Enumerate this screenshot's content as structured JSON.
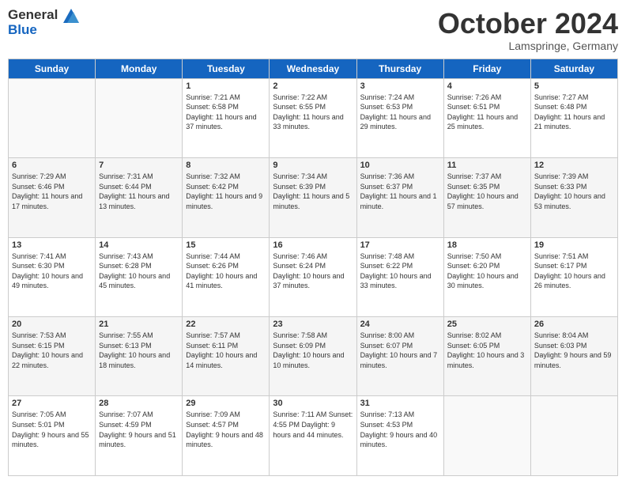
{
  "logo": {
    "line1": "General",
    "line2": "Blue"
  },
  "title": "October 2024",
  "location": "Lamspringe, Germany",
  "days_of_week": [
    "Sunday",
    "Monday",
    "Tuesday",
    "Wednesday",
    "Thursday",
    "Friday",
    "Saturday"
  ],
  "weeks": [
    [
      {
        "day": "",
        "info": ""
      },
      {
        "day": "",
        "info": ""
      },
      {
        "day": "1",
        "info": "Sunrise: 7:21 AM\nSunset: 6:58 PM\nDaylight: 11 hours and 37 minutes."
      },
      {
        "day": "2",
        "info": "Sunrise: 7:22 AM\nSunset: 6:55 PM\nDaylight: 11 hours and 33 minutes."
      },
      {
        "day": "3",
        "info": "Sunrise: 7:24 AM\nSunset: 6:53 PM\nDaylight: 11 hours and 29 minutes."
      },
      {
        "day": "4",
        "info": "Sunrise: 7:26 AM\nSunset: 6:51 PM\nDaylight: 11 hours and 25 minutes."
      },
      {
        "day": "5",
        "info": "Sunrise: 7:27 AM\nSunset: 6:48 PM\nDaylight: 11 hours and 21 minutes."
      }
    ],
    [
      {
        "day": "6",
        "info": "Sunrise: 7:29 AM\nSunset: 6:46 PM\nDaylight: 11 hours and 17 minutes."
      },
      {
        "day": "7",
        "info": "Sunrise: 7:31 AM\nSunset: 6:44 PM\nDaylight: 11 hours and 13 minutes."
      },
      {
        "day": "8",
        "info": "Sunrise: 7:32 AM\nSunset: 6:42 PM\nDaylight: 11 hours and 9 minutes."
      },
      {
        "day": "9",
        "info": "Sunrise: 7:34 AM\nSunset: 6:39 PM\nDaylight: 11 hours and 5 minutes."
      },
      {
        "day": "10",
        "info": "Sunrise: 7:36 AM\nSunset: 6:37 PM\nDaylight: 11 hours and 1 minute."
      },
      {
        "day": "11",
        "info": "Sunrise: 7:37 AM\nSunset: 6:35 PM\nDaylight: 10 hours and 57 minutes."
      },
      {
        "day": "12",
        "info": "Sunrise: 7:39 AM\nSunset: 6:33 PM\nDaylight: 10 hours and 53 minutes."
      }
    ],
    [
      {
        "day": "13",
        "info": "Sunrise: 7:41 AM\nSunset: 6:30 PM\nDaylight: 10 hours and 49 minutes."
      },
      {
        "day": "14",
        "info": "Sunrise: 7:43 AM\nSunset: 6:28 PM\nDaylight: 10 hours and 45 minutes."
      },
      {
        "day": "15",
        "info": "Sunrise: 7:44 AM\nSunset: 6:26 PM\nDaylight: 10 hours and 41 minutes."
      },
      {
        "day": "16",
        "info": "Sunrise: 7:46 AM\nSunset: 6:24 PM\nDaylight: 10 hours and 37 minutes."
      },
      {
        "day": "17",
        "info": "Sunrise: 7:48 AM\nSunset: 6:22 PM\nDaylight: 10 hours and 33 minutes."
      },
      {
        "day": "18",
        "info": "Sunrise: 7:50 AM\nSunset: 6:20 PM\nDaylight: 10 hours and 30 minutes."
      },
      {
        "day": "19",
        "info": "Sunrise: 7:51 AM\nSunset: 6:17 PM\nDaylight: 10 hours and 26 minutes."
      }
    ],
    [
      {
        "day": "20",
        "info": "Sunrise: 7:53 AM\nSunset: 6:15 PM\nDaylight: 10 hours and 22 minutes."
      },
      {
        "day": "21",
        "info": "Sunrise: 7:55 AM\nSunset: 6:13 PM\nDaylight: 10 hours and 18 minutes."
      },
      {
        "day": "22",
        "info": "Sunrise: 7:57 AM\nSunset: 6:11 PM\nDaylight: 10 hours and 14 minutes."
      },
      {
        "day": "23",
        "info": "Sunrise: 7:58 AM\nSunset: 6:09 PM\nDaylight: 10 hours and 10 minutes."
      },
      {
        "day": "24",
        "info": "Sunrise: 8:00 AM\nSunset: 6:07 PM\nDaylight: 10 hours and 7 minutes."
      },
      {
        "day": "25",
        "info": "Sunrise: 8:02 AM\nSunset: 6:05 PM\nDaylight: 10 hours and 3 minutes."
      },
      {
        "day": "26",
        "info": "Sunrise: 8:04 AM\nSunset: 6:03 PM\nDaylight: 9 hours and 59 minutes."
      }
    ],
    [
      {
        "day": "27",
        "info": "Sunrise: 7:05 AM\nSunset: 5:01 PM\nDaylight: 9 hours and 55 minutes."
      },
      {
        "day": "28",
        "info": "Sunrise: 7:07 AM\nSunset: 4:59 PM\nDaylight: 9 hours and 51 minutes."
      },
      {
        "day": "29",
        "info": "Sunrise: 7:09 AM\nSunset: 4:57 PM\nDaylight: 9 hours and 48 minutes."
      },
      {
        "day": "30",
        "info": "Sunrise: 7:11 AM\nSunset: 4:55 PM\nDaylight: 9 hours and 44 minutes."
      },
      {
        "day": "31",
        "info": "Sunrise: 7:13 AM\nSunset: 4:53 PM\nDaylight: 9 hours and 40 minutes."
      },
      {
        "day": "",
        "info": ""
      },
      {
        "day": "",
        "info": ""
      }
    ]
  ]
}
